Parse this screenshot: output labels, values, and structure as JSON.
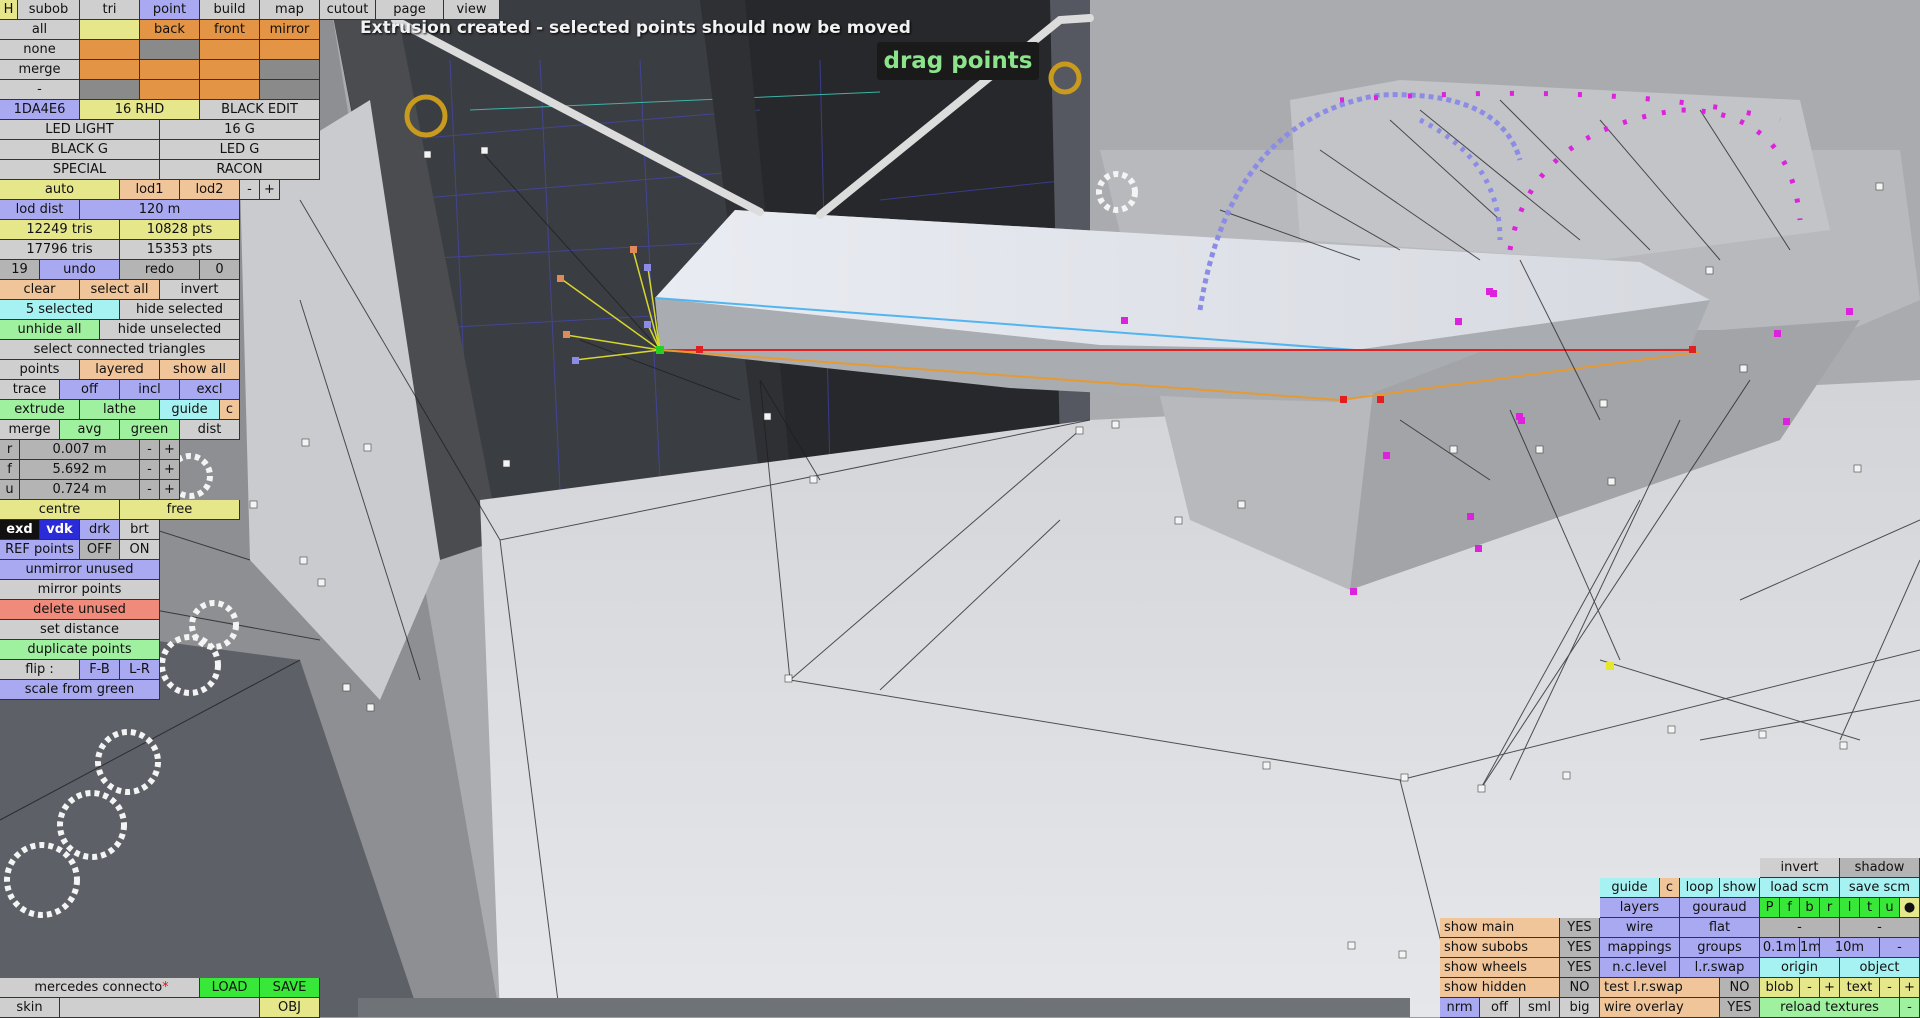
{
  "status_message": "Extrusion created - selected points should now be moved",
  "mode_label": "drag points",
  "colors": {
    "yellow": "#e6e68a",
    "orange": "#e39545",
    "lightgray": "#cfcfcf",
    "gray": "#b4b4b4",
    "darkgray": "#8a8a8a",
    "blue": "#a9a9f2",
    "paleorange": "#f1c59a",
    "green": "#9ff09f",
    "cyan": "#a6f2f2",
    "red": "#f08a7a",
    "brightgreen": "#38e838",
    "black": "#111111",
    "white": "#f2f2f2",
    "darkblue": "#2b2bd8",
    "green_point": "#23d023",
    "red_point": "#e02020",
    "magenta_point": "#dd22dd"
  },
  "left_panel": {
    "top_tabs": [
      {
        "label": "H",
        "col": "yellow"
      },
      {
        "label": "subob",
        "col": "lightgray"
      },
      {
        "label": "tri",
        "col": "lightgray"
      },
      {
        "label": "point",
        "col": "blue"
      },
      {
        "label": "build",
        "col": "lightgray"
      },
      {
        "label": "map",
        "col": "lightgray"
      },
      {
        "label": "cutout",
        "col": "lightgray"
      },
      {
        "label": "page",
        "col": "lightgray"
      },
      {
        "label": "view",
        "col": "lightgray"
      }
    ],
    "select_rows": [
      {
        "label": "all",
        "cells": [
          {
            "t": "",
            "col": "yellow"
          },
          {
            "t": "back",
            "col": "orange"
          },
          {
            "t": "front",
            "col": "orange"
          },
          {
            "t": "mirror",
            "col": "orange"
          }
        ]
      },
      {
        "label": "none",
        "cells": [
          {
            "t": "",
            "col": "orange"
          },
          {
            "t": "",
            "col": "darkgray"
          },
          {
            "t": "",
            "col": "orange"
          },
          {
            "t": "",
            "col": "orange"
          }
        ]
      },
      {
        "label": "merge",
        "cells": [
          {
            "t": "",
            "col": "orange"
          },
          {
            "t": "",
            "col": "orange"
          },
          {
            "t": "",
            "col": "orange"
          },
          {
            "t": "",
            "col": "darkgray"
          }
        ]
      },
      {
        "label": "-",
        "cells": [
          {
            "t": "",
            "col": "darkgray"
          },
          {
            "t": "",
            "col": "orange"
          },
          {
            "t": "",
            "col": "orange"
          },
          {
            "t": "",
            "col": "darkgray"
          }
        ]
      }
    ],
    "mat_rows": [
      [
        {
          "t": "1DA4E6",
          "col": "blue"
        },
        {
          "t": "16 RHD",
          "col": "yellow"
        },
        {
          "t": "BLACK EDIT",
          "col": "lightgray"
        }
      ],
      [
        {
          "t": "LED LIGHT",
          "col": "lightgray"
        },
        {
          "t": "16 G",
          "col": "lightgray"
        }
      ],
      [
        {
          "t": "BLACK G",
          "col": "lightgray"
        },
        {
          "t": "LED G",
          "col": "lightgray"
        }
      ],
      [
        {
          "t": "SPECIAL",
          "col": "lightgray"
        },
        {
          "t": "RACON",
          "col": "lightgray"
        }
      ]
    ],
    "lod_row": [
      {
        "t": "auto",
        "col": "yellow"
      },
      {
        "t": "lod1",
        "col": "paleorange"
      },
      {
        "t": "lod2",
        "col": "paleorange"
      },
      {
        "t": "-",
        "col": "lightgray"
      },
      {
        "t": "+",
        "col": "lightgray"
      }
    ],
    "lod_dist": {
      "label": "lod dist",
      "value": "120 m"
    },
    "stats1": {
      "tris": "12249 tris",
      "pts": "10828 pts"
    },
    "stats2": {
      "tris": "17796 tris",
      "pts": "15353 pts"
    },
    "undo_row": [
      {
        "t": "19",
        "col": "gray"
      },
      {
        "t": "undo",
        "col": "blue"
      },
      {
        "t": "redo",
        "col": "gray"
      },
      {
        "t": "0",
        "col": "gray"
      }
    ],
    "clear_row": [
      {
        "t": "clear",
        "col": "paleorange"
      },
      {
        "t": "select all",
        "col": "paleorange"
      },
      {
        "t": "invert",
        "col": "lightgray"
      }
    ],
    "selected_row": [
      {
        "t": "5 selected",
        "col": "cyan"
      },
      {
        "t": "hide selected",
        "col": "lightgray"
      }
    ],
    "unhide_row": [
      {
        "t": "unhide all",
        "col": "green"
      },
      {
        "t": "hide unselected",
        "col": "lightgray"
      }
    ],
    "connected": "select connected triangles",
    "points_row": [
      {
        "t": "points",
        "col": "lightgray"
      },
      {
        "t": "layered",
        "col": "paleorange"
      },
      {
        "t": "show all",
        "col": "paleorange"
      }
    ],
    "trace_row": [
      {
        "t": "trace",
        "col": "lightgray"
      },
      {
        "t": "off",
        "col": "blue"
      },
      {
        "t": "incl",
        "col": "blue"
      },
      {
        "t": "excl",
        "col": "blue"
      }
    ],
    "extrude_row": [
      {
        "t": "extrude",
        "col": "green"
      },
      {
        "t": "lathe",
        "col": "green"
      },
      {
        "t": "guide",
        "col": "cyan"
      },
      {
        "t": "c",
        "col": "paleorange"
      }
    ],
    "merge_row": [
      {
        "t": "merge",
        "col": "lightgray"
      },
      {
        "t": "avg",
        "col": "green"
      },
      {
        "t": "green",
        "col": "green"
      },
      {
        "t": "dist",
        "col": "lightgray"
      }
    ],
    "coords": [
      {
        "axis": "r",
        "value": "0.007 m"
      },
      {
        "axis": "f",
        "value": "5.692 m"
      },
      {
        "axis": "u",
        "value": "0.724 m"
      }
    ],
    "stepper": {
      "minus": "-",
      "plus": "+"
    },
    "centre_row": [
      {
        "t": "centre",
        "col": "yellow"
      },
      {
        "t": "free",
        "col": "yellow"
      }
    ],
    "view_row": [
      {
        "t": "exd",
        "col": "black"
      },
      {
        "t": "vdk",
        "col": "darkblue"
      },
      {
        "t": "drk",
        "col": "blue"
      },
      {
        "t": "brt",
        "col": "lightgray"
      }
    ],
    "ref_row": [
      {
        "t": "REF points",
        "col": "blue"
      },
      {
        "t": "OFF",
        "col": "gray"
      },
      {
        "t": "ON",
        "col": "lightgray"
      }
    ],
    "unmirror": "unmirror unused",
    "mirror_points": "mirror points",
    "delete_unused": "delete unused",
    "set_distance": "set distance",
    "duplicate_points": "duplicate points",
    "flip_row": [
      {
        "t": "flip :",
        "col": "lightgray"
      },
      {
        "t": "F-B",
        "col": "blue"
      },
      {
        "t": "L-R",
        "col": "blue"
      }
    ],
    "scale_green": "scale from green"
  },
  "bottom_left": {
    "filename": "mercedes connecto",
    "modified_mark": "*",
    "load": "LOAD",
    "save": "SAVE",
    "skin": "skin",
    "obj": "OBJ"
  },
  "right_panel": {
    "row0": [
      {
        "t": "invert",
        "col": "lightgray"
      },
      {
        "t": "shadow",
        "col": "gray"
      }
    ],
    "row1": [
      {
        "t": "guide",
        "col": "cyan"
      },
      {
        "t": "c",
        "col": "paleorange"
      },
      {
        "t": "loop",
        "col": "cyan"
      },
      {
        "t": "show",
        "col": "cyan"
      },
      {
        "t": "load scm",
        "col": "cyan"
      },
      {
        "t": "save scm",
        "col": "cyan"
      }
    ],
    "row2": [
      {
        "t": "layers",
        "col": "blue"
      },
      {
        "t": "gouraud",
        "col": "blue"
      }
    ],
    "layer_toggles": [
      {
        "t": "P",
        "col": "brightgreen"
      },
      {
        "t": "f",
        "col": "brightgreen"
      },
      {
        "t": "b",
        "col": "brightgreen"
      },
      {
        "t": "r",
        "col": "brightgreen"
      },
      {
        "t": "l",
        "col": "brightgreen"
      },
      {
        "t": "t",
        "col": "brightgreen"
      },
      {
        "t": "u",
        "col": "brightgreen"
      },
      {
        "t": "●",
        "col": "yellow"
      }
    ],
    "show_rows": [
      {
        "label": "show main",
        "value": "YES"
      },
      {
        "label": "show subobs",
        "value": "YES"
      },
      {
        "label": "show wheels",
        "value": "YES"
      },
      {
        "label": "show hidden",
        "value": "NO"
      }
    ],
    "mid_rows": [
      [
        {
          "t": "wire",
          "col": "blue"
        },
        {
          "t": "flat",
          "col": "blue"
        }
      ],
      [
        {
          "t": "mappings",
          "col": "blue"
        },
        {
          "t": "groups",
          "col": "blue"
        }
      ],
      [
        {
          "t": "n.c.level",
          "col": "blue"
        },
        {
          "t": "l.r.swap",
          "col": "blue"
        }
      ]
    ],
    "rg_rows": [
      [
        {
          "t": "-",
          "col": "gray"
        },
        {
          "t": "-",
          "col": "gray"
        }
      ],
      [
        {
          "t": "0.1m",
          "col": "blue"
        },
        {
          "t": "1m",
          "col": "blue"
        },
        {
          "t": "10m",
          "col": "blue"
        },
        {
          "t": "-",
          "col": "blue"
        }
      ],
      [
        {
          "t": "origin",
          "col": "cyan"
        },
        {
          "t": "object",
          "col": "cyan"
        }
      ]
    ],
    "test_swap": {
      "label": "test l.r.swap",
      "value": "NO"
    },
    "blob_row": [
      {
        "t": "blob",
        "col": "yellow"
      },
      {
        "t": "-",
        "col": "yellow"
      },
      {
        "t": "+",
        "col": "yellow"
      },
      {
        "t": "text",
        "col": "yellow"
      },
      {
        "t": "-",
        "col": "yellow"
      },
      {
        "t": "+",
        "col": "yellow"
      }
    ],
    "res_row": [
      {
        "t": "nrm",
        "col": "blue"
      },
      {
        "t": "off",
        "col": "lightgray"
      },
      {
        "t": "sml",
        "col": "lightgray"
      },
      {
        "t": "big",
        "col": "lightgray"
      }
    ],
    "wire_overlay": {
      "label": "wire overlay",
      "value": "YES"
    },
    "reload": "reload textures",
    "reload_end": "-"
  }
}
